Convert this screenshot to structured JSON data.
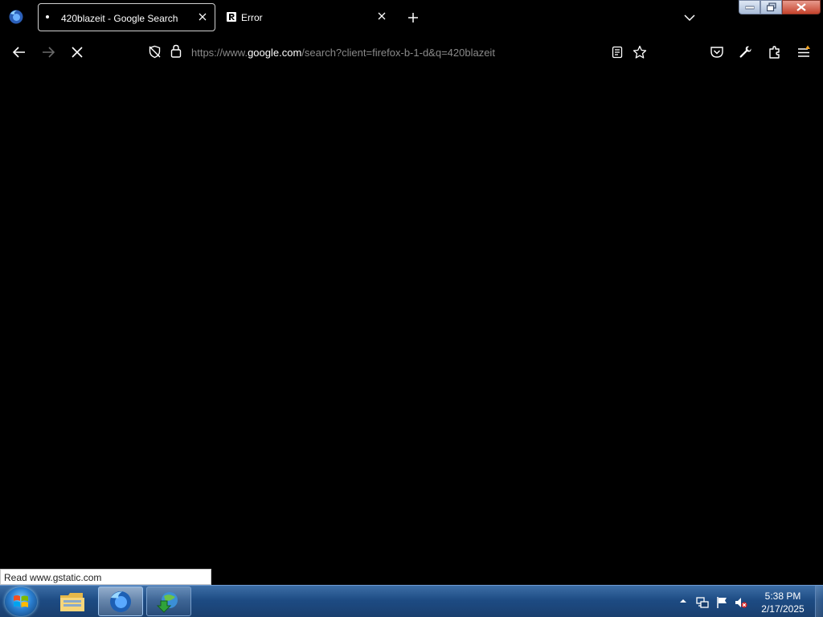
{
  "browser": {
    "tabs": [
      {
        "title": "420blazeit - Google Search",
        "active": true,
        "loading": true
      },
      {
        "title": "Error",
        "active": false,
        "favicon": "r-letter-icon"
      }
    ],
    "icons": {
      "app": "firefox-icon",
      "new_tab": "plus-icon",
      "list_tabs": "chevron-down-icon"
    }
  },
  "navbar": {
    "url_prefix": "https://www.",
    "url_domain": "google.com",
    "url_suffix": "/search?client=firefox-b-1-d&q=420blazeit",
    "stop_state": "loading"
  },
  "status_bar": {
    "text": "Read www.gstatic.com"
  },
  "taskbar": {
    "pinned": [
      "windows-explorer-icon",
      "firefox-icon",
      "internet-download-manager-icon"
    ],
    "active_app": "firefox-icon",
    "clock": {
      "time": "5:38 PM",
      "date": "2/17/2025"
    },
    "tray_icons": [
      "show-hidden-icons-arrow",
      "network-icon",
      "action-center-flag-icon",
      "volume-muted-icon"
    ]
  },
  "colors": {
    "page_background": "#000000",
    "taskbar_blue": "#1d4b83"
  }
}
